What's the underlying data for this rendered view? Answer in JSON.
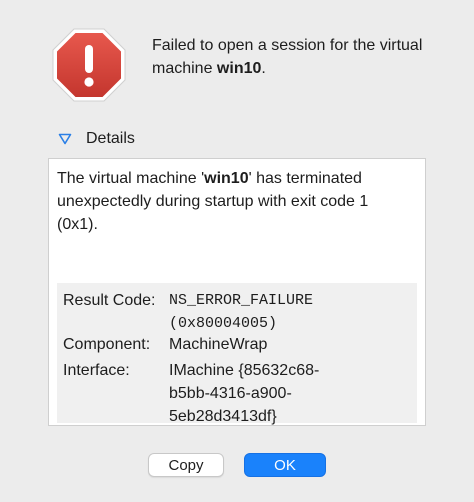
{
  "alert": {
    "icon": "stop-sign-exclamation-icon",
    "message_prefix": "Failed to open a session for the virtual machine ",
    "vm_name": "win10",
    "message_suffix": "."
  },
  "details": {
    "toggle_label": "Details",
    "expanded": true,
    "message_prefix": "The virtual machine '",
    "vm_name": "win10",
    "message_suffix": "' has terminated unexpectedly during startup with exit code 1 (0x1).",
    "result_code_label": "Result Code:",
    "result_code_value": "NS_ERROR_FAILURE (0x80004005)",
    "component_label": "Component:",
    "component_value": "MachineWrap",
    "interface_label": "Interface:",
    "interface_value": "IMachine {85632c68-b5bb-4316-a900-5eb28d3413df}"
  },
  "buttons": {
    "copy_label": "Copy",
    "ok_label": "OK"
  },
  "colors": {
    "stop_red": "#d9443b",
    "accent_blue": "#1a82fb",
    "background": "#ececec"
  }
}
